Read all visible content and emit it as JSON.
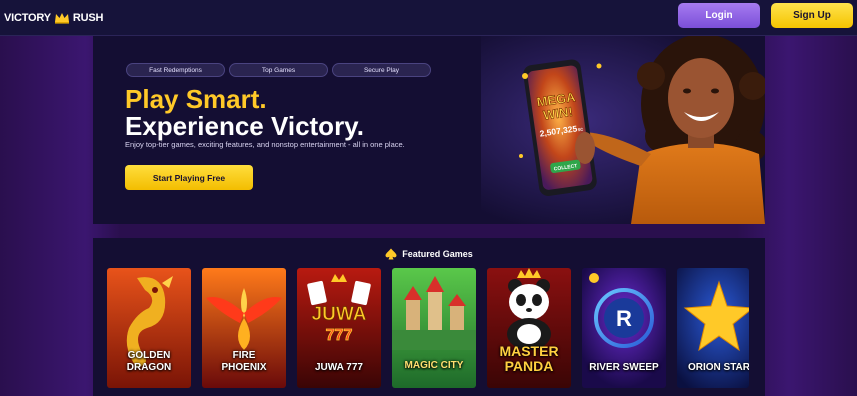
{
  "header": {
    "logo": {
      "left": "VICTORY",
      "right": "RUSH",
      "icon": "crown-icon"
    },
    "login_label": "Login",
    "signup_label": "Sign Up"
  },
  "hero": {
    "pills": [
      "Fast Redemptions",
      "Top Games",
      "Secure Play"
    ],
    "title_line1": "Play Smart.",
    "title_line2": "Experience Victory.",
    "subtitle": "Enjoy top-tier games, exciting features, and nonstop entertainment - all in one place.",
    "cta_label": "Start Playing Free",
    "phone": {
      "line1": "MEGA",
      "line2": "WIN!",
      "amount": "2,507,325",
      "unit": "SC",
      "collect": "COLLECT"
    }
  },
  "featured": {
    "title": "Featured Games",
    "icon": "spade-icon",
    "games": [
      {
        "name_line1": "GOLDEN",
        "name_line2": "DRAGON"
      },
      {
        "name_line1": "FIRE",
        "name_line2": "PHOENIX"
      },
      {
        "logo_line1": "JUWA",
        "logo_line2": "777",
        "name_line1": "JUWA 777"
      },
      {
        "name_line1": "MAGIC CITY"
      },
      {
        "name_line1": "MASTER",
        "name_line2": "PANDA"
      },
      {
        "logo": "R",
        "name_line1": "RIVER SWEEP"
      },
      {
        "name_line1": "ORION STAR"
      }
    ]
  },
  "colors": {
    "accent_gold": "#ffc928",
    "accent_purple": "#7b4fd8",
    "panel": "#140e33",
    "header": "#16133a"
  }
}
